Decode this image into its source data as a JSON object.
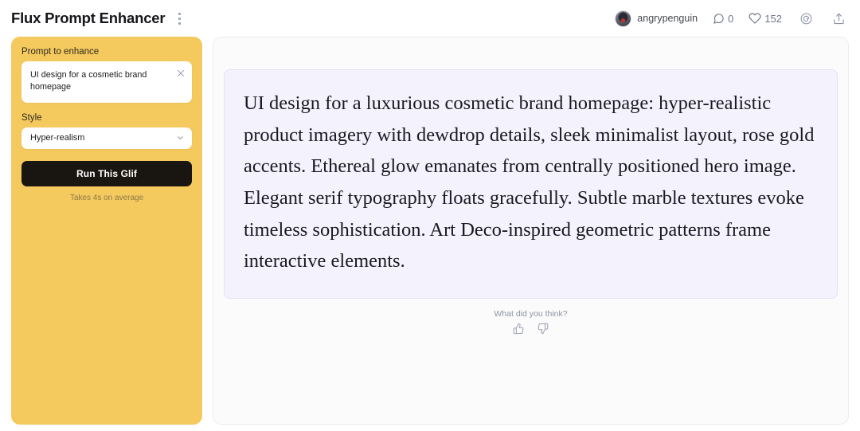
{
  "header": {
    "title": "Flux Prompt Enhancer",
    "menu_icon": "kebab-menu-icon",
    "user": {
      "name": "angrypenguin",
      "avatar_icon": "avatar-penguin"
    },
    "stats": {
      "comments_icon": "comment-bubble-icon",
      "comments_count": "0",
      "likes_icon": "heart-icon",
      "likes_count": "152"
    },
    "remix_icon": "spiral-remix-icon",
    "share_icon": "share-upload-icon"
  },
  "sidebar": {
    "prompt_label": "Prompt to enhance",
    "prompt_value": "UI design for a cosmetic brand homepage",
    "prompt_placeholder": "Prompt to enhance",
    "clear_icon": "close-x-icon",
    "style_label": "Style",
    "style_value": "Hyper-realism",
    "chevron_icon": "chevron-down-icon",
    "run_label": "Run This Glif",
    "avg_note": "Takes 4s on average",
    "accent_color": "#f4c95e",
    "button_color": "#191511"
  },
  "main": {
    "result_text": "UI design for a luxurious cosmetic brand homepage: hyper-realistic product imagery with dewdrop details, sleek minimalist layout, rose gold accents. Ethereal glow emanates from centrally positioned hero image. Elegant serif typography floats gracefully. Subtle marble textures evoke timeless sophistication. Art Deco-inspired geometric patterns frame interactive elements.",
    "result_bg_color": "#f4f2fd",
    "feedback_question": "What did you think?",
    "thumbs_up_icon": "thumbs-up-icon",
    "thumbs_down_icon": "thumbs-down-icon"
  }
}
